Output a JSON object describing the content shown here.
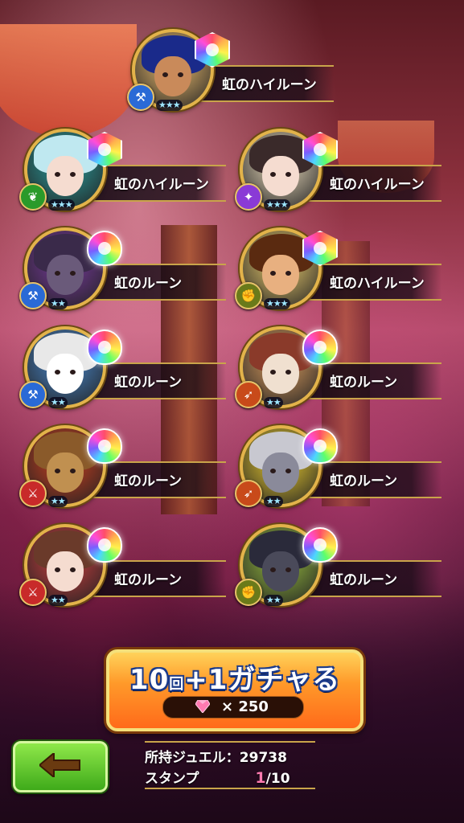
{
  "colors": {
    "frame_gold": "#e2b34a",
    "button_orange": "#ff9a2a",
    "back_green": "#3faa1a",
    "stamp_highlight": "#ff7ab0"
  },
  "results": [
    {
      "label": "虹のハイルーン",
      "rune": "high",
      "stars": "★★★",
      "attribute_icon": "ax-icon",
      "attr_color": "#2a6ad6",
      "hair": "#1a2a8a",
      "skin": "#c98a5a",
      "bg": "#f0c070"
    },
    {
      "label": "虹のハイルーン",
      "rune": "high",
      "stars": "★★★",
      "attribute_icon": "leaf-icon",
      "attr_color": "#2a9a2a",
      "hair": "#bfe8f0",
      "skin": "#f5dcd0",
      "bg": "#2aa0a0"
    },
    {
      "label": "虹のハイルーン",
      "rune": "high",
      "stars": "★★★",
      "attribute_icon": "magic-icon",
      "attr_color": "#8a3ad6",
      "hair": "#3a2a2a",
      "skin": "#f5dcd0",
      "bg": "#f0e0c0"
    },
    {
      "label": "虹のルーン",
      "rune": "basic",
      "stars": "★★",
      "attribute_icon": "ax-icon",
      "attr_color": "#2a6ad6",
      "hair": "#3a2a4a",
      "skin": "#6a5a7a",
      "bg": "#7a3aa0"
    },
    {
      "label": "虹のハイルーン",
      "rune": "high",
      "stars": "★★★",
      "attribute_icon": "fist-icon",
      "attr_color": "#6a7a1a",
      "hair": "#5a2a10",
      "skin": "#e8b080",
      "bg": "#f0d070"
    },
    {
      "label": "虹のルーン",
      "rune": "basic",
      "stars": "★★",
      "attribute_icon": "ax-icon",
      "attr_color": "#2a6ad6",
      "hair": "#e8e8e8",
      "skin": "#ffffff",
      "bg": "#4a8ad0"
    },
    {
      "label": "虹のルーン",
      "rune": "basic",
      "stars": "★★",
      "attribute_icon": "bow-icon",
      "attr_color": "#c84a1a",
      "hair": "#8a3a2a",
      "skin": "#f0e0d0",
      "bg": "#e0a060"
    },
    {
      "label": "虹のルーン",
      "rune": "basic",
      "stars": "★★",
      "attribute_icon": "sword-icon",
      "attr_color": "#c82a2a",
      "hair": "#8a5a2a",
      "skin": "#c09050",
      "bg": "#d04020"
    },
    {
      "label": "虹のルーン",
      "rune": "basic",
      "stars": "★★",
      "attribute_icon": "bow-icon",
      "attr_color": "#c84a1a",
      "hair": "#c8c8d0",
      "skin": "#8a8a9a",
      "bg": "#f0d030"
    },
    {
      "label": "虹のルーン",
      "rune": "basic",
      "stars": "★★",
      "attribute_icon": "sword-icon",
      "attr_color": "#c82a2a",
      "hair": "#6a3a2a",
      "skin": "#f5dcd0",
      "bg": "#d04040"
    },
    {
      "label": "虹のルーン",
      "rune": "basic",
      "stars": "★★",
      "attribute_icon": "fist-icon",
      "attr_color": "#6a7a1a",
      "hair": "#2a2a3a",
      "skin": "#4a4a5a",
      "bg": "#9ac040"
    }
  ],
  "gacha_button": {
    "title_10": "10",
    "title_kai": "回",
    "title_plus1": "+1",
    "title_rest": "ガチャる",
    "cost": "× 250"
  },
  "back_button": {
    "icon": "left-arrow-icon"
  },
  "info": {
    "jewel_line": "所持ジュエル：29738",
    "stamp_label": "スタンプ",
    "stamp_value": "1",
    "stamp_max": "/10"
  }
}
